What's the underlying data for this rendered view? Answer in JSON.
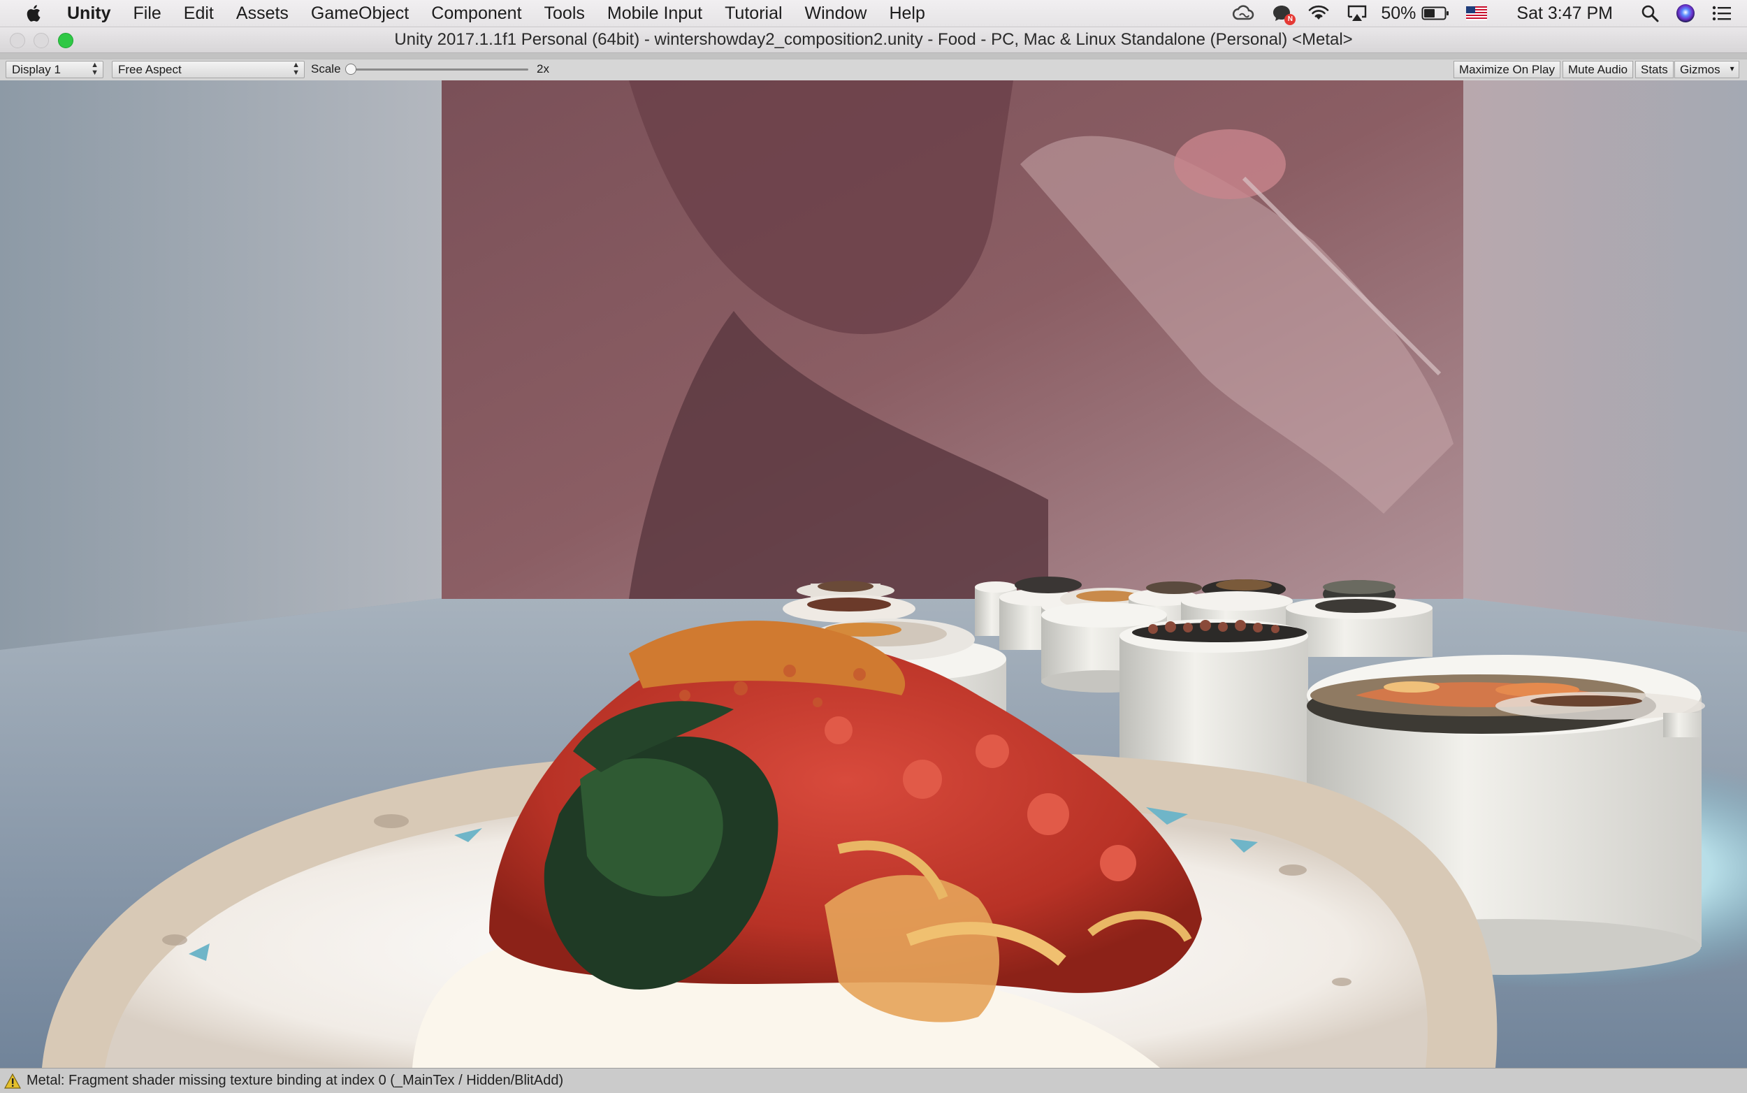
{
  "menubar": {
    "app_name": "Unity",
    "items": [
      "File",
      "Edit",
      "Assets",
      "GameObject",
      "Component",
      "Tools",
      "Mobile Input",
      "Tutorial",
      "Window",
      "Help"
    ],
    "status": {
      "battery": "50%",
      "clock": "Sat 3:47 PM",
      "notification_badge": "N"
    }
  },
  "window": {
    "title": "Unity 2017.1.1f1 Personal (64bit) - wintershowday2_composition2.unity - Food - PC, Mac & Linux Standalone (Personal) <Metal>"
  },
  "game_toolbar": {
    "display": "Display 1",
    "aspect": "Free Aspect",
    "scale_label": "Scale",
    "scale_value": "2x",
    "maximize_on_play": "Maximize On Play",
    "mute_audio": "Mute Audio",
    "stats": "Stats",
    "gizmos": "Gizmos"
  },
  "console_status": {
    "message": "Metal: Fragment shader missing texture binding at index 0 (_MainTex / Hidden/BlitAdd)"
  },
  "scene": {
    "description_icons": [
      "warning-icon"
    ]
  }
}
